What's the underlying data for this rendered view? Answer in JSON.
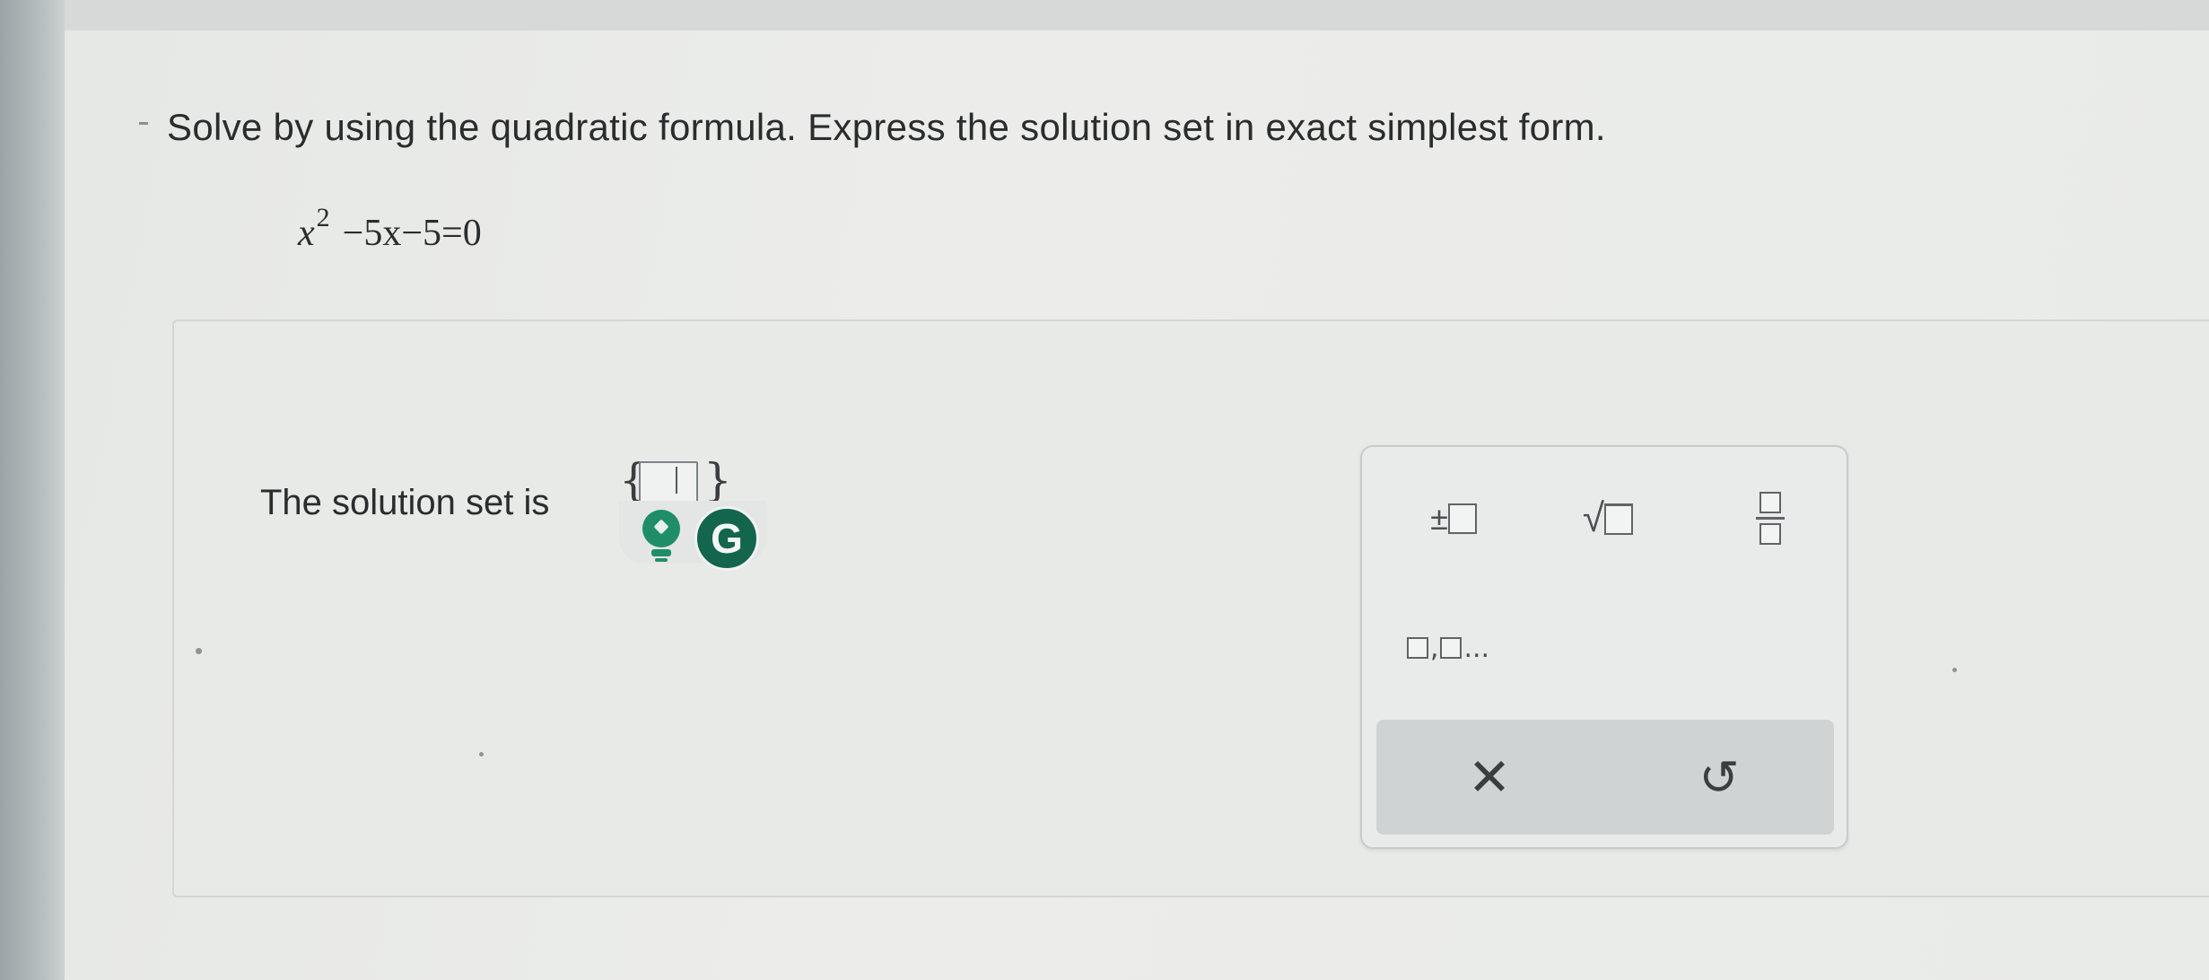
{
  "question": {
    "prompt": "Solve by using the quadratic formula. Express the solution set in exact simplest form.",
    "equation": {
      "variable": "x",
      "exponent": "2",
      "rest": "−5x−5=0"
    }
  },
  "answer": {
    "label": "The solution set is",
    "brace_left": "{",
    "brace_right": "}"
  },
  "extensions": {
    "grammarly_letter": "G"
  },
  "keypad": {
    "plus_minus": "±",
    "sqrt_symbol": "√",
    "list_separator": ",",
    "list_ellipsis": "...",
    "clear": "✕",
    "undo": "↺"
  },
  "colors": {
    "grammarly": "#14654d",
    "hint_bulb": "#1f8e68",
    "action_bar": "#cfd3d3"
  },
  "icons": [
    "lightbulb-icon",
    "grammarly-icon",
    "clear-icon",
    "undo-icon"
  ]
}
